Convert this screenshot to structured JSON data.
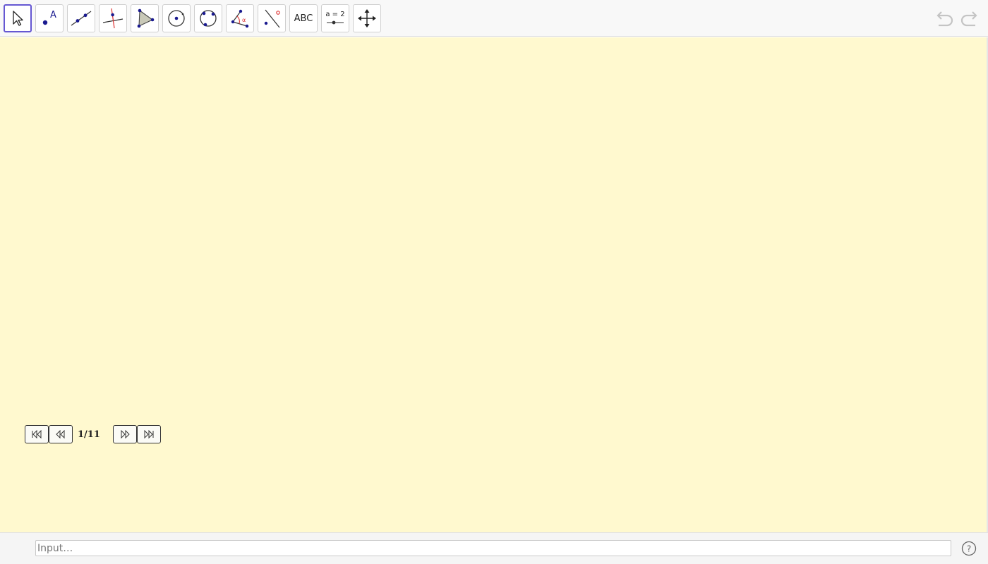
{
  "toolbar": {
    "tools": [
      {
        "name": "move",
        "icon": "cursor-arrow-icon",
        "selected": true
      },
      {
        "name": "point",
        "icon": "point-icon",
        "text": "A"
      },
      {
        "name": "line",
        "icon": "line-through-points-icon"
      },
      {
        "name": "perpendicular-line",
        "icon": "perpendicular-line-icon"
      },
      {
        "name": "polygon",
        "icon": "polygon-icon"
      },
      {
        "name": "circle-center-point",
        "icon": "circle-center-icon"
      },
      {
        "name": "circle-three-points",
        "icon": "circle-three-points-icon"
      },
      {
        "name": "angle",
        "icon": "angle-icon",
        "text": "α"
      },
      {
        "name": "reflect",
        "icon": "reflect-point-icon"
      },
      {
        "name": "text",
        "icon": "text-tool-icon",
        "text": "ABC"
      },
      {
        "name": "slider",
        "icon": "slider-icon",
        "text": "a = 2"
      },
      {
        "name": "move-graphics-view",
        "icon": "move-view-icon"
      }
    ],
    "undo_icon": "undo-icon",
    "redo_icon": "redo-icon"
  },
  "colors": {
    "graphics_bg": "#fff9cf",
    "selected_border": "#6557d2",
    "point_blue": "#1a1a8f",
    "accent_red": "#d33"
  },
  "navigation": {
    "step_label": "1/11",
    "buttons": {
      "first": "skip-to-first-icon",
      "previous": "step-back-icon",
      "next": "step-forward-icon",
      "last": "skip-to-last-icon"
    }
  },
  "input": {
    "placeholder": "Input…",
    "value": ""
  },
  "help": {
    "label": "?"
  }
}
